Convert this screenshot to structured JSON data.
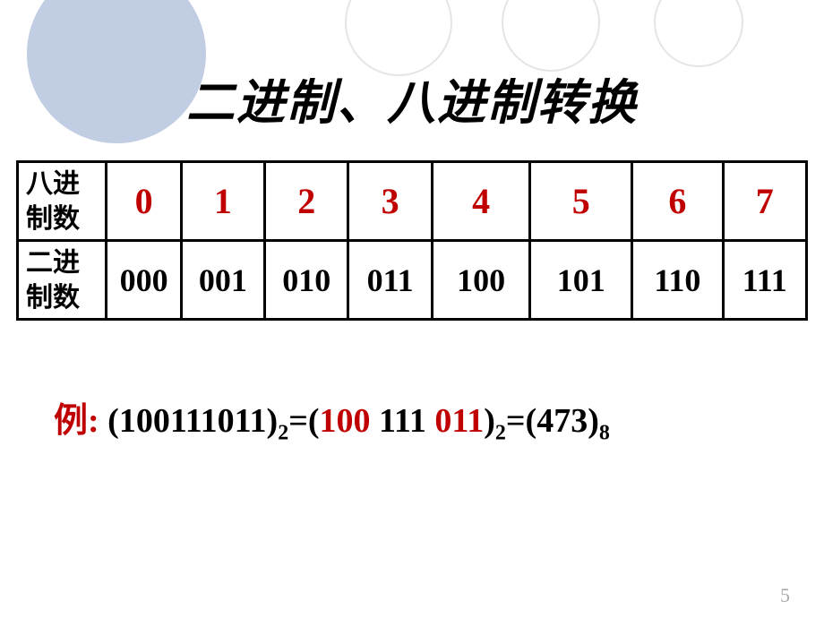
{
  "title": "二进制、八进制转换",
  "row1_label": "八进\n制数",
  "row2_label": "二进\n制数",
  "octal": [
    "0",
    "1",
    "2",
    "3",
    "4",
    "5",
    "6",
    "7"
  ],
  "binary": [
    "000",
    "001",
    "010",
    "011",
    "100",
    "101",
    "110",
    "111"
  ],
  "example": {
    "label": "例",
    "colon": ": ",
    "lp1": "(",
    "v1": "100111011",
    "rp1": ")",
    "sub1": "2",
    "eq1": "=(",
    "g1": "100",
    "sp1": " ",
    "g2": "111",
    "sp2": " ",
    "g3": "011",
    "rp2": ")",
    "sub2": "2",
    "eq2": "=(",
    "r": "473",
    "rp3": ")",
    "sub3": "8"
  },
  "pagenum": "5",
  "chart_data": {
    "type": "table",
    "title": "二进制、八进制转换",
    "rows": [
      {
        "label": "八进制数",
        "values": [
          "0",
          "1",
          "2",
          "3",
          "4",
          "5",
          "6",
          "7"
        ]
      },
      {
        "label": "二进制数",
        "values": [
          "000",
          "001",
          "010",
          "011",
          "100",
          "101",
          "110",
          "111"
        ]
      }
    ],
    "example": "(100111011)₂ = (100 111 011)₂ = (473)₈"
  }
}
